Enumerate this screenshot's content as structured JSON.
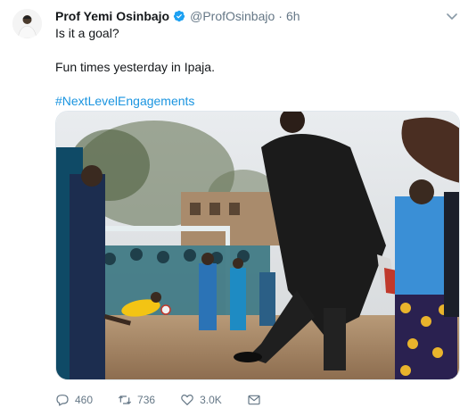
{
  "author": {
    "name": "Prof Yemi Osinbajo",
    "handle": "@ProfOsinbajo",
    "separator": "·",
    "time": "6h"
  },
  "tweet": {
    "line1": "Is it a goal?",
    "line2": "Fun times yesterday in Ipaja.",
    "hashtag": "#NextLevelEngagements"
  },
  "actions": {
    "replies": "460",
    "retweets": "736",
    "likes": "3.0K"
  },
  "colors": {
    "link": "#1b95e0",
    "verified": "#1da1f2",
    "secondary": "#657786"
  }
}
